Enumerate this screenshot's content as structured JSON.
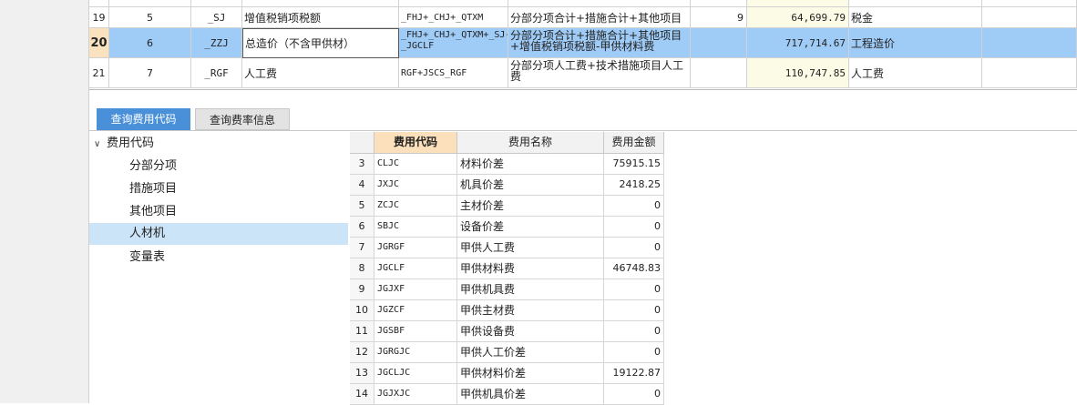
{
  "top_table": {
    "rows": [
      {
        "rownum": "19",
        "seq": "5",
        "code": "_SJ",
        "name": "增值税销项税额",
        "base": "_FHJ+_CHJ+_QTXM",
        "base_desc": "分部分项合计+措施合计+其他项目",
        "rate": "9",
        "amount": "64,699.79",
        "category": "税金"
      },
      {
        "rownum": "20",
        "seq": "6",
        "code": "_ZZJ",
        "name": "总造价（不含甲供材）",
        "base": "_FHJ+_CHJ+_QTXM+_SJ-_JGCLF",
        "base_desc": "分部分项合计+措施合计+其他项目+增值税销项税额-甲供材料费",
        "rate": "",
        "amount": "717,714.67",
        "category": "工程造价"
      },
      {
        "rownum": "21",
        "seq": "7",
        "code": "_RGF",
        "name": "人工费",
        "base": "RGF+JSCS_RGF",
        "base_desc": "分部分项人工费+技术措施项目人工费",
        "rate": "",
        "amount": "110,747.85",
        "category": "人工费"
      }
    ]
  },
  "tabs": {
    "query_code": "查询费用代码",
    "query_rate": "查询费率信息"
  },
  "tree": {
    "root": "费用代码",
    "items": [
      "分部分项",
      "措施项目",
      "其他项目",
      "人材机",
      "变量表"
    ],
    "selected": "人材机"
  },
  "code_table": {
    "headers": {
      "code": "费用代码",
      "name": "费用名称",
      "amount": "费用金额"
    },
    "rows": [
      {
        "num": "3",
        "code": "CLJC",
        "name": "材料价差",
        "amount": "75915.15"
      },
      {
        "num": "4",
        "code": "JXJC",
        "name": "机具价差",
        "amount": "2418.25"
      },
      {
        "num": "5",
        "code": "ZCJC",
        "name": "主材价差",
        "amount": "0"
      },
      {
        "num": "6",
        "code": "SBJC",
        "name": "设备价差",
        "amount": "0"
      },
      {
        "num": "7",
        "code": "JGRGF",
        "name": "甲供人工费",
        "amount": "0"
      },
      {
        "num": "8",
        "code": "JGCLF",
        "name": "甲供材料费",
        "amount": "46748.83"
      },
      {
        "num": "9",
        "code": "JGJXF",
        "name": "甲供机具费",
        "amount": "0"
      },
      {
        "num": "10",
        "code": "JGZCF",
        "name": "甲供主材费",
        "amount": "0"
      },
      {
        "num": "11",
        "code": "JGSBF",
        "name": "甲供设备费",
        "amount": "0"
      },
      {
        "num": "12",
        "code": "JGRGJC",
        "name": "甲供人工价差",
        "amount": "0"
      },
      {
        "num": "13",
        "code": "JGCLJC",
        "name": "甲供材料价差",
        "amount": "19122.87"
      },
      {
        "num": "14",
        "code": "JGJXJC",
        "name": "甲供机具价差",
        "amount": "0"
      }
    ]
  },
  "colors": {
    "accent": "#4a90d9",
    "selected_row": "#9fcbf7",
    "selected_tree": "#cce4f7",
    "header_highlight": "#fbe0bb"
  }
}
